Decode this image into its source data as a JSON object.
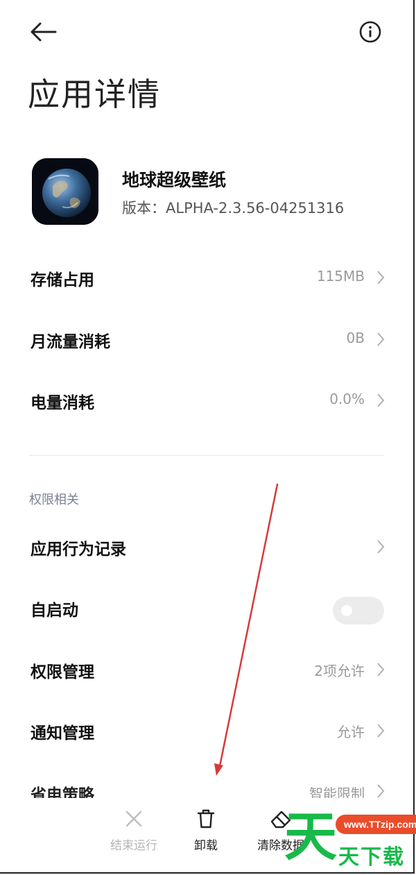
{
  "header": {
    "title": "应用详情"
  },
  "app": {
    "name": "地球超级壁纸",
    "version": "版本：ALPHA-2.3.56-04251316"
  },
  "usage": [
    {
      "label": "存储占用",
      "value": "115MB"
    },
    {
      "label": "月流量消耗",
      "value": "0B"
    },
    {
      "label": "电量消耗",
      "value": "0.0%"
    }
  ],
  "permissions": {
    "section_label": "权限相关",
    "behavior_log": {
      "label": "应用行为记录"
    },
    "autostart": {
      "label": "自启动",
      "enabled": false
    },
    "permission_mgmt": {
      "label": "权限管理",
      "value": "2项允许"
    },
    "notification_mgmt": {
      "label": "通知管理",
      "value": "允许"
    },
    "power_saving": {
      "label": "省电策略",
      "value": "智能限制"
    }
  },
  "actions": [
    {
      "label": "结束运行",
      "icon": "close-icon",
      "enabled": false
    },
    {
      "label": "卸载",
      "icon": "trash-icon",
      "enabled": true
    },
    {
      "label": "清除数据",
      "icon": "eraser-icon",
      "enabled": true
    }
  ],
  "watermark": {
    "big": "天",
    "url": "www.TTzip.com",
    "text": "天下载"
  },
  "colors": {
    "annotation_arrow": "#d63a3a",
    "watermark_green": "#18b94a",
    "watermark_red": "#ea4c2a"
  }
}
